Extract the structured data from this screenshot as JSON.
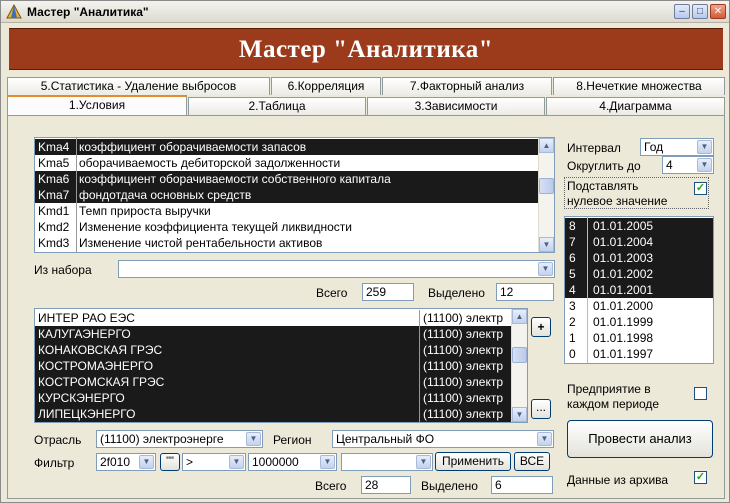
{
  "window": {
    "title": "Мастер \"Аналитика\"",
    "banner": "Мастер \"Аналитика\"",
    "controls": [
      "–",
      "□",
      "✕"
    ]
  },
  "tabs_top": [
    "5.Статистика - Удаление выбросов",
    "6.Корреляция",
    "7.Факторный анализ",
    "8.Нечеткие множества"
  ],
  "tabs_bottom": [
    "1.Условия",
    "2.Таблица",
    "3.Зависимости",
    "4.Диаграмма"
  ],
  "active_tab": "1.Условия",
  "indicators": [
    {
      "code": "Kma4",
      "desc": "коэффициент оборачиваемости запасов",
      "selected": true
    },
    {
      "code": "Kma5",
      "desc": "оборачиваемость дебиторской задолженности",
      "selected": false
    },
    {
      "code": "Kma6",
      "desc": "коэффициент оборачиваемости собственного капитала",
      "selected": true
    },
    {
      "code": "Kma7",
      "desc": "фондотдача основных средств",
      "selected": true
    },
    {
      "code": "Kmd1",
      "desc": "Темп прироста выручки",
      "selected": false
    },
    {
      "code": "Kmd2",
      "desc": "Изменение коэффициента текущей ликвидности",
      "selected": false
    },
    {
      "code": "Kmd3",
      "desc": "Изменение чистой рентабельности активов",
      "selected": false
    }
  ],
  "from_set": {
    "label": "Из набора",
    "value": ""
  },
  "indicators_summary": {
    "total_label": "Всего",
    "total": "259",
    "selected_label": "Выделено",
    "selected": "12"
  },
  "enterprises": [
    {
      "name": "ИНТЕР РАО ЕЭС",
      "industry": "(11100) электр",
      "selected": false
    },
    {
      "name": "КАЛУГАЭНЕРГО",
      "industry": "(11100) электр",
      "selected": true
    },
    {
      "name": "КОНАКОВСКАЯ ГРЭС",
      "industry": "(11100) электр",
      "selected": true
    },
    {
      "name": "КОСТРОМАЭНЕРГО",
      "industry": "(11100) электр",
      "selected": true
    },
    {
      "name": "КОСТРОМСКАЯ ГРЭС",
      "industry": "(11100) электр",
      "selected": true
    },
    {
      "name": "КУРСКЭНЕРГО",
      "industry": "(11100) электр",
      "selected": true
    },
    {
      "name": "ЛИПЕЦКЭНЕРГО",
      "industry": "(11100) электр",
      "selected": true
    }
  ],
  "buttons": {
    "add": "+",
    "more": "...",
    "apply": "Применить",
    "all": "ВСЕ",
    "run": "Провести анализ",
    "quote": "\"\""
  },
  "industry": {
    "label": "Отрасль",
    "value": "(11100) электроэнерге"
  },
  "region": {
    "label": "Регион",
    "value": "Центральный ФО"
  },
  "filter": {
    "label": "Фильтр",
    "field": "2f010",
    "operator": ">",
    "value": "1000000",
    "extra": ""
  },
  "enterprises_summary": {
    "total_label": "Всего",
    "total": "28",
    "selected_label": "Выделено",
    "selected": "6"
  },
  "interval": {
    "label": "Интервал",
    "value": "Год"
  },
  "round_to": {
    "label": "Округлить до",
    "value": "4"
  },
  "substitute_zero": {
    "label_line1": "Подставлять",
    "label_line2": "нулевое значение",
    "checked": true
  },
  "dates": [
    {
      "num": "8",
      "date": "01.01.2005",
      "selected": true
    },
    {
      "num": "7",
      "date": "01.01.2004",
      "selected": true
    },
    {
      "num": "6",
      "date": "01.01.2003",
      "selected": true
    },
    {
      "num": "5",
      "date": "01.01.2002",
      "selected": true
    },
    {
      "num": "4",
      "date": "01.01.2001",
      "selected": true
    },
    {
      "num": "3",
      "date": "01.01.2000",
      "selected": false
    },
    {
      "num": "2",
      "date": "01.01.1999",
      "selected": false
    },
    {
      "num": "1",
      "date": "01.01.1998",
      "selected": false
    },
    {
      "num": "0",
      "date": "01.01.1997",
      "selected": false
    }
  ],
  "each_period": {
    "label_line1": "Предприятие в",
    "label_line2": "каждом периоде",
    "checked": false
  },
  "archive": {
    "label": "Данные из архива",
    "checked": true
  },
  "icons": {
    "app": "pyramid-icon",
    "check": "✓",
    "arrow_down": "▼",
    "arrow_up": "▲"
  }
}
